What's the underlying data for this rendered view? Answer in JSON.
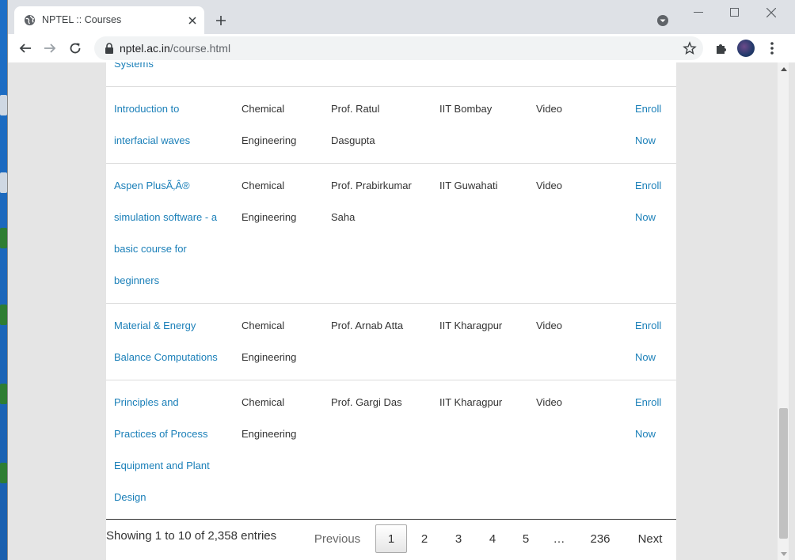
{
  "browser": {
    "tab_title": "NPTEL :: Courses",
    "url_host": "nptel.ac.in",
    "url_path": "/course.html"
  },
  "table": {
    "top_fragment": "Systems",
    "rows": [
      {
        "course": [
          "Introduction to",
          "interfacial waves"
        ],
        "discipline": [
          "Chemical",
          "Engineering"
        ],
        "coordinator": [
          "Prof. Ratul",
          "Dasgupta"
        ],
        "institute": "IIT Bombay",
        "type": "Video",
        "action": [
          "Enroll",
          "Now"
        ]
      },
      {
        "course": [
          "Aspen PlusÃ‚Â®",
          "simulation software - a",
          "basic course for",
          "beginners"
        ],
        "discipline": [
          "Chemical",
          "Engineering"
        ],
        "coordinator": [
          "Prof. Prabirkumar",
          "Saha"
        ],
        "institute": "IIT Guwahati",
        "type": "Video",
        "action": [
          "Enroll",
          "Now"
        ]
      },
      {
        "course": [
          "Material & Energy",
          "Balance Computations"
        ],
        "discipline": [
          "Chemical",
          "Engineering"
        ],
        "coordinator": [
          "Prof. Arnab Atta"
        ],
        "institute": "IIT Kharagpur",
        "type": "Video",
        "action": [
          "Enroll",
          "Now"
        ]
      },
      {
        "course": [
          "Principles and",
          "Practices of Process",
          "Equipment and Plant",
          "Design"
        ],
        "discipline": [
          "Chemical",
          "Engineering"
        ],
        "coordinator": [
          "Prof. Gargi Das"
        ],
        "institute": "IIT Kharagpur",
        "type": "Video",
        "action": [
          "Enroll",
          "Now"
        ]
      }
    ]
  },
  "pagination": {
    "info": "Showing 1 to 10 of 2,358 entries",
    "previous": "Previous",
    "pages": [
      "1",
      "2",
      "3",
      "4",
      "5"
    ],
    "ellipsis": "…",
    "last": "236",
    "next": "Next",
    "current": "1"
  }
}
